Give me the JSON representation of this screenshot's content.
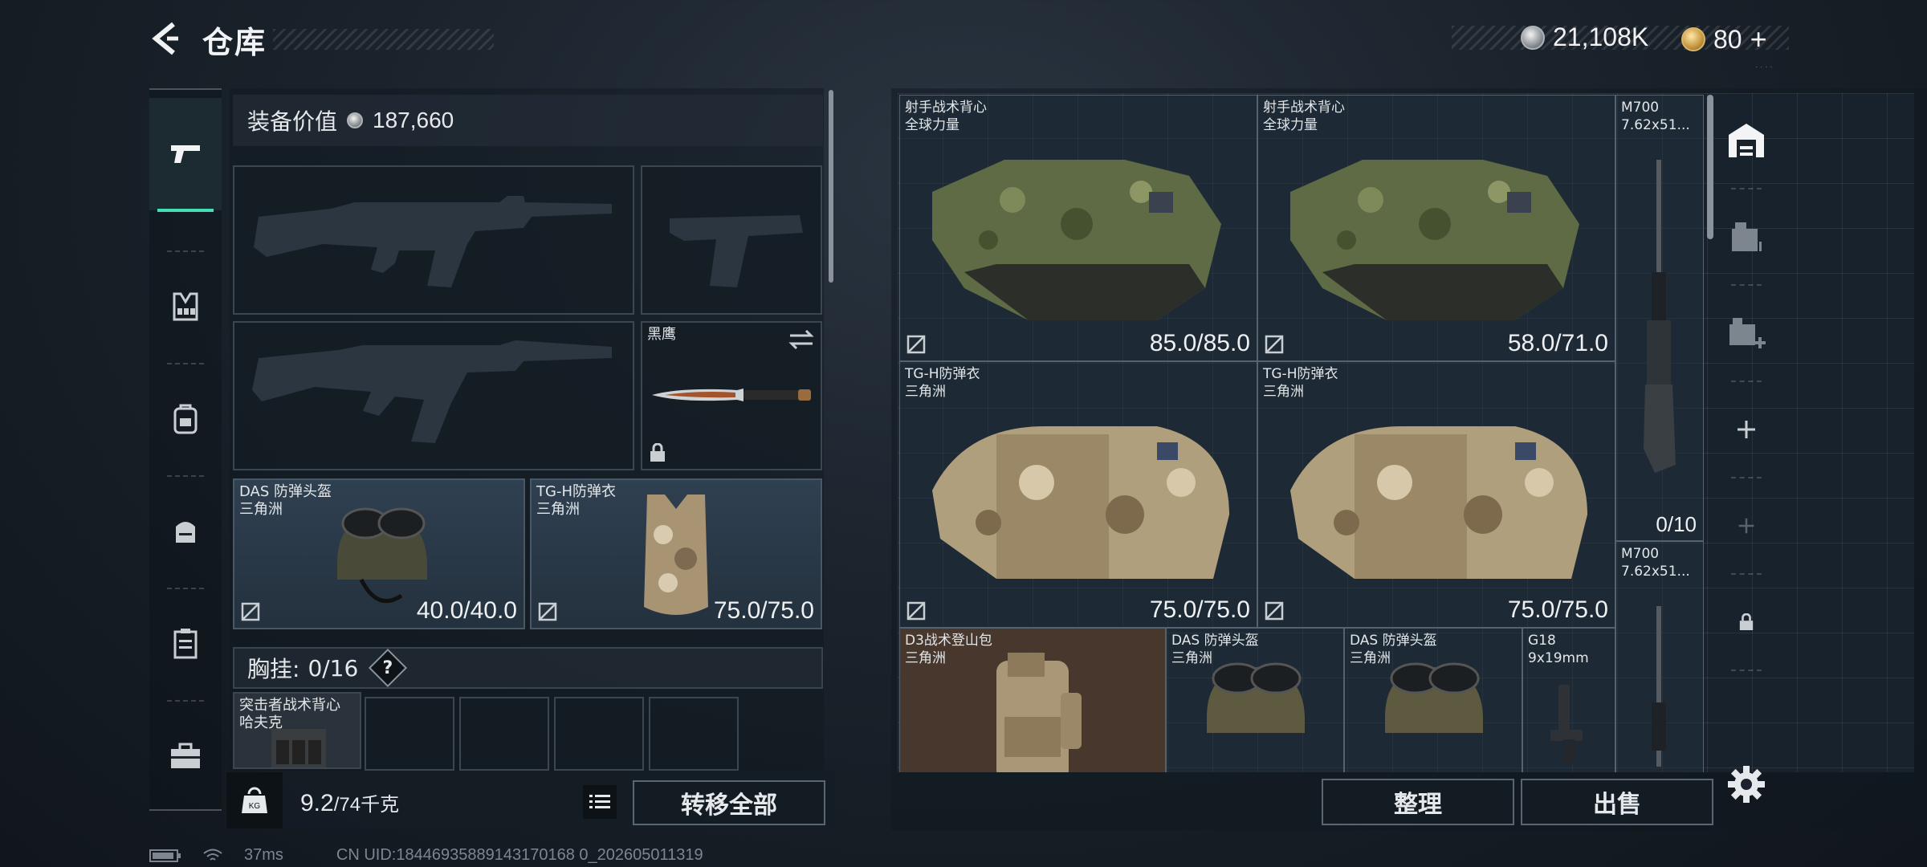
{
  "header": {
    "title": "仓库",
    "currency_silver": "21,108K",
    "currency_gold": "80",
    "gold_plus": "+"
  },
  "left_nav": {
    "items": [
      {
        "name": "weapons",
        "icon": "pistol-icon",
        "active": true
      },
      {
        "name": "vest",
        "icon": "vest-icon"
      },
      {
        "name": "backpack",
        "icon": "backpack-icon"
      },
      {
        "name": "pouch",
        "icon": "pouch-icon"
      },
      {
        "name": "case",
        "icon": "case-icon"
      },
      {
        "name": "toolbox",
        "icon": "toolbox-icon"
      }
    ]
  },
  "equipment": {
    "value_label": "装备价值",
    "value": "187,660",
    "melee": {
      "name": "黑鹰"
    },
    "helmet": {
      "name": "DAS 防弹头盔",
      "sub": "三角洲",
      "durability": "40.0/40.0"
    },
    "armor": {
      "name": "TG-H防弹衣",
      "sub": "三角洲",
      "durability": "75.0/75.0"
    },
    "chest_rig": {
      "label": "胸挂:",
      "capacity": "0/16",
      "help": "?"
    },
    "rig_item": {
      "name": "突击者战术背心",
      "sub": "哈夫克"
    },
    "weight": "9.2",
    "weight_max": "/74千克",
    "transfer_label": "转移全部"
  },
  "warehouse": {
    "items": [
      {
        "name": "射手战术背心",
        "sub": "全球力量",
        "durability": "85.0/85.0"
      },
      {
        "name": "射手战术背心",
        "sub": "全球力量",
        "durability": "58.0/71.0"
      },
      {
        "name": "TG-H防弹衣",
        "sub": "三角洲",
        "durability": "75.0/75.0"
      },
      {
        "name": "TG-H防弹衣",
        "sub": "三角洲",
        "durability": "75.0/75.0"
      },
      {
        "name": "M700",
        "sub": "7.62x51...",
        "ammo": "0/10"
      },
      {
        "name": "M700",
        "sub": "7.62x51..."
      },
      {
        "name": "D3战术登山包",
        "sub": "三角洲"
      },
      {
        "name": "DAS 防弹头盔",
        "sub": "三角洲"
      },
      {
        "name": "DAS 防弹头盔",
        "sub": "三角洲"
      },
      {
        "name": "G18",
        "sub": "9x19mm"
      }
    ],
    "sort_label": "整理",
    "sell_label": "出售"
  },
  "status": {
    "ping": "37ms",
    "uid": "CN UID:18446935889143170168 0_202605011319"
  }
}
